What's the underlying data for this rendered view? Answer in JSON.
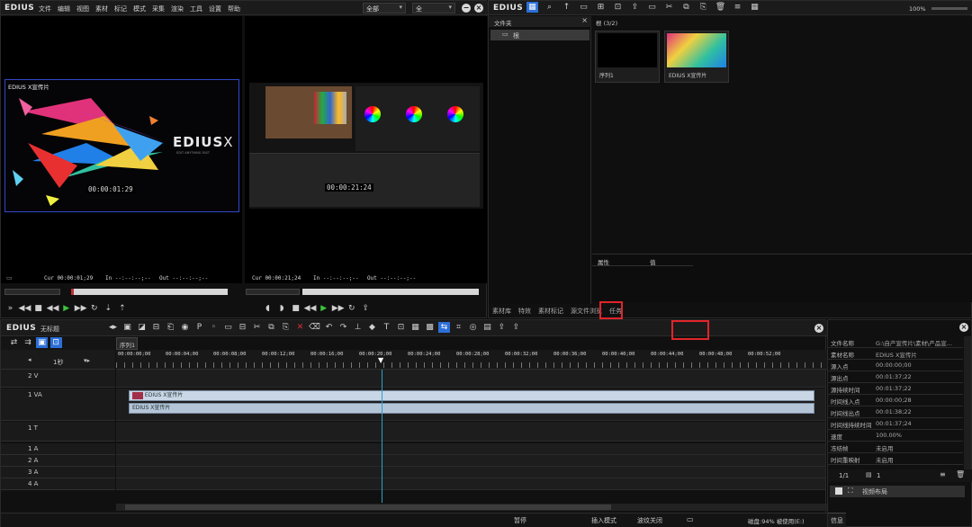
{
  "player": {
    "logo": "EDIUS",
    "menu": [
      "文件",
      "编辑",
      "视图",
      "素材",
      "标记",
      "模式",
      "采集",
      "渲染",
      "工具",
      "设置",
      "帮助"
    ],
    "left_dropdown": "全部",
    "right_dropdown": "全",
    "source_label": "EDIUS X宣传片",
    "overlay_left_tc": "00:00:01:29",
    "overlay_right_tc": "00:00:21:24",
    "left_cur": "Cur 00:00:01;29",
    "left_in": "In --:--:--;--",
    "left_out": "Out --:--:--;--",
    "right_cur": "Cur 00:00:21;24",
    "right_in": "In --:--:--;--",
    "right_out": "Out --:--:--;--",
    "edius_brand": "EDIUS",
    "edius_brand_x": "X",
    "edius_tagline": "EDIT ANYTHING FAST"
  },
  "bin": {
    "logo": "EDIUS",
    "zoom": "100%",
    "folder_panel_title": "文件夹",
    "root_folder": "根",
    "breadcrumb": "根 (3/2)",
    "assets": [
      {
        "name": "序列1"
      },
      {
        "name": "EDIUS X宣传片"
      }
    ],
    "prop_col1": "属性",
    "prop_col2": "值",
    "tabs": [
      "素材库",
      "特效",
      "素材标记",
      "源文件浏览",
      "任务"
    ]
  },
  "timeline": {
    "logo": "EDIUS",
    "project": "无标题",
    "sequence_tab": "序列1",
    "scale": "1秒",
    "ruler": [
      "00:00:00;00",
      "00:00:04;00",
      "00:00:08;00",
      "00:00:12;00",
      "00:00:16;00",
      "00:00:20;00",
      "00:00:24;00",
      "00:00:28;00",
      "00:00:32;00",
      "00:00:36;00",
      "00:00:40;00",
      "00:00:44;00",
      "00:00:48;00",
      "00:00:52;00"
    ],
    "tracks": [
      {
        "name": "2 V"
      },
      {
        "name": "1 VA"
      },
      {
        "name": "1 T"
      },
      {
        "name": "1 A"
      },
      {
        "name": "2 A"
      },
      {
        "name": "3 A"
      },
      {
        "name": "4 A"
      }
    ],
    "clip_video": "EDIUS X宣传片",
    "clip_audio": "EDIUS X宣传片",
    "status": {
      "s1": "暂停",
      "s2": "插入模式",
      "s3": "波纹关闭",
      "s4": "磁盘:94% 被使用(E:)"
    }
  },
  "info": {
    "rows": [
      {
        "k": "文件名称",
        "v": "G:\\自产宣传片\\素材\\产品宣..."
      },
      {
        "k": "素材名称",
        "v": "EDIUS X宣传片"
      },
      {
        "k": "源入点",
        "v": "00:00:00;00"
      },
      {
        "k": "源出点",
        "v": "00:01:37;22"
      },
      {
        "k": "源持续时间",
        "v": "00:01:37;22"
      },
      {
        "k": "时间线入点",
        "v": "00:00:00;28"
      },
      {
        "k": "时间线出点",
        "v": "00:01:38;22"
      },
      {
        "k": "时间线持续时间",
        "v": "00:01:37;24"
      },
      {
        "k": "速度",
        "v": "100.00%"
      },
      {
        "k": "冻结帧",
        "v": "未启用"
      },
      {
        "k": "时间重映射",
        "v": "未启用"
      }
    ],
    "page": "1/1",
    "count": "1",
    "effect": "视频布局",
    "tab": "信息"
  }
}
